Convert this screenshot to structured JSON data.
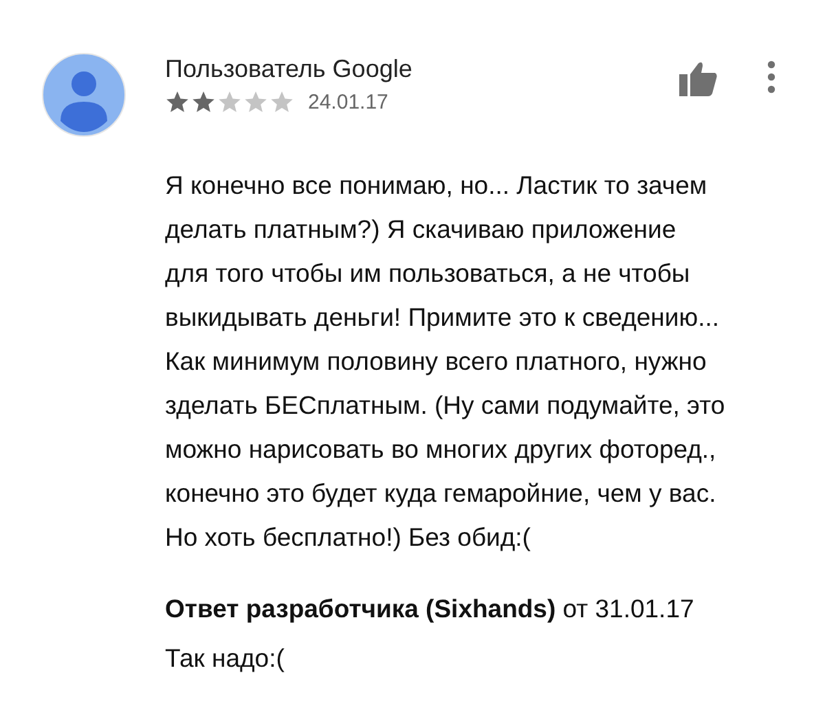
{
  "review": {
    "author": "Пользователь Google",
    "stars": 2,
    "date": "24.01.17",
    "text": "Я конечно все понимаю, но... Ластик то зачем\nделать платным?) Я скачиваю приложение\nдля того чтобы им пользоваться, а не чтобы\nвыкидывать деньги! Примите это к сведению...\nКак минимум половину всего платного, нужно\nзделать БЕСплатным. (Ну сами подумайте, это\nможно нарисовать во многих других фоторед.,\nконечно это будет куда гемаройние, чем у вас.\nНо хоть бесплатно!) Без обид:("
  },
  "reply": {
    "header": "**Ответ разработчика (Sixhands)** от 31.01.17",
    "text": "Так надо:("
  }
}
